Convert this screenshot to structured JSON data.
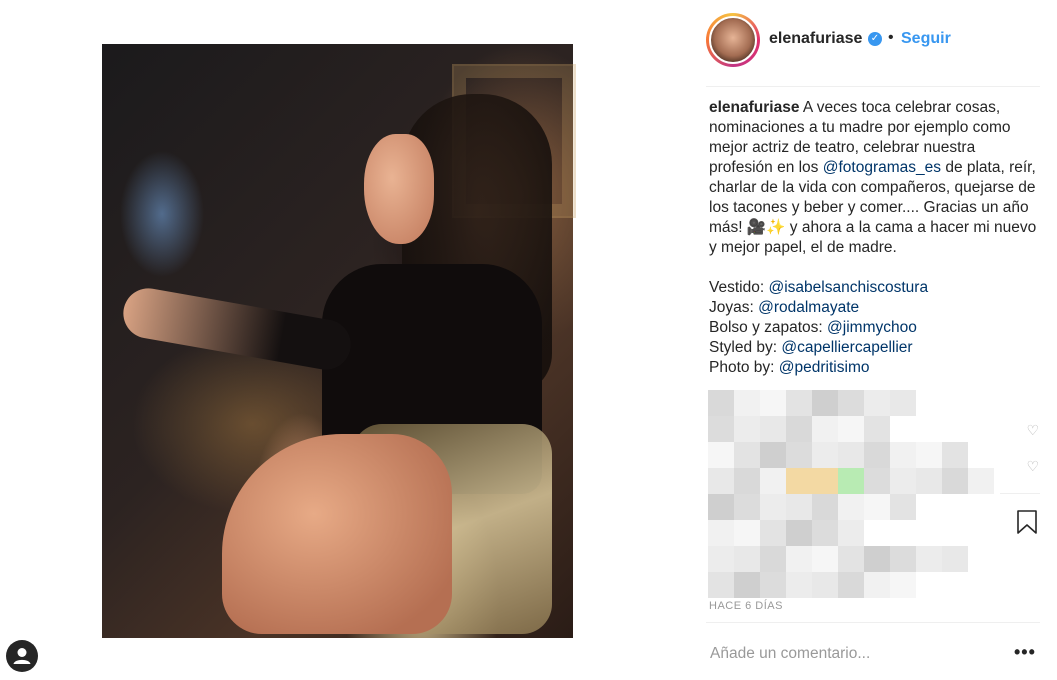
{
  "post": {
    "username": "elenafuriase",
    "separator": "•",
    "follow_label": "Seguir",
    "caption_lines": [
      "A veces toca celebrar cosas, nominaciones a tu madre por ejemplo como mejor actriz de teatro, celebrar nuestra profesión en los ",
      "@fotogramas_es",
      " de plata, reír, charlar de la vida con compañeros, quejarse de los tacones y beber y comer.... Gracias un año más! 🎥✨ y ahora a la cama a hacer mi nuevo y mejor papel, el de madre."
    ],
    "credits": [
      {
        "label": "Vestido: ",
        "mention": "@isabelsanchiscostura"
      },
      {
        "label": "Joyas: ",
        "mention": "@rodalmayate"
      },
      {
        "label": "Bolso y zapatos: ",
        "mention": "@jimmychoo"
      },
      {
        "label": "Styled by: ",
        "mention": "@capelliercapellier"
      },
      {
        "label": "Photo by: ",
        "mention": "@pedritisimo"
      }
    ],
    "time_ago": "HACE 6 DÍAS",
    "comment_placeholder": "Añade un comentario...",
    "more_label": "•••"
  },
  "icons": {
    "verified": "verified-badge-icon",
    "heart": "heart-outline-icon",
    "bookmark": "bookmark-icon",
    "profile": "user-silhouette-icon"
  },
  "colors": {
    "accent": "#3897f0",
    "mention": "#003569",
    "text": "#262626",
    "muted": "#999999"
  }
}
